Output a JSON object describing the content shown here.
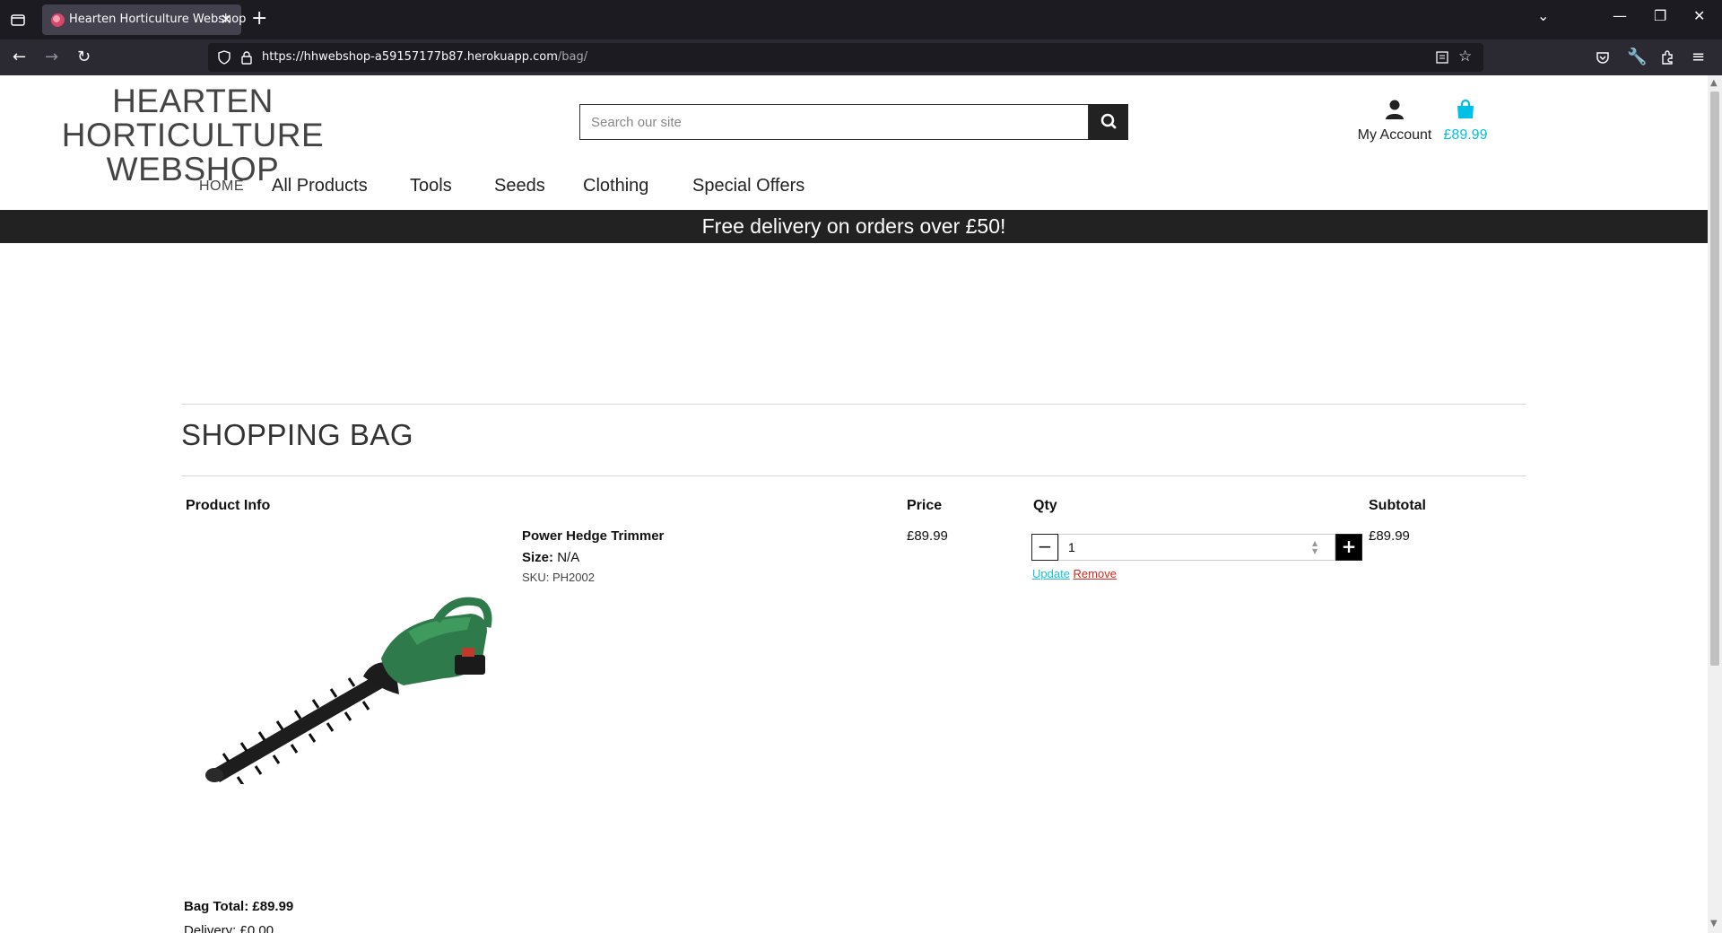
{
  "browser": {
    "tab_title": "Hearten Horticulture Webshop",
    "url_host": "https://hhwebshop-a59157177b87.herokuapp.com",
    "url_path": "/bag/"
  },
  "site": {
    "logo_line1": "HEARTEN HORTICULTURE",
    "logo_line2": "WEBSHOP",
    "search_placeholder": "Search our site",
    "account_label": "My Account",
    "bag_total": "£89.99",
    "accent_color": "#00c0e8"
  },
  "nav": {
    "home": "HOME",
    "all_products": "All Products",
    "tools": "Tools",
    "seeds": "Seeds",
    "clothing": "Clothing",
    "special_offers": "Special Offers"
  },
  "banner": "Free delivery on orders over £50!",
  "bag": {
    "title": "SHOPPING BAG",
    "headers": {
      "product_info": "Product Info",
      "price": "Price",
      "qty": "Qty",
      "subtotal": "Subtotal"
    },
    "item": {
      "name": "Power Hedge Trimmer",
      "size_label": "Size:",
      "size_value": "N/A",
      "sku": "SKU: PH2002",
      "price": "£89.99",
      "qty": "1",
      "subtotal": "£89.99",
      "update": "Update",
      "remove": "Remove"
    },
    "bag_total": "Bag Total: £89.99",
    "delivery": "Delivery: £0.00"
  }
}
